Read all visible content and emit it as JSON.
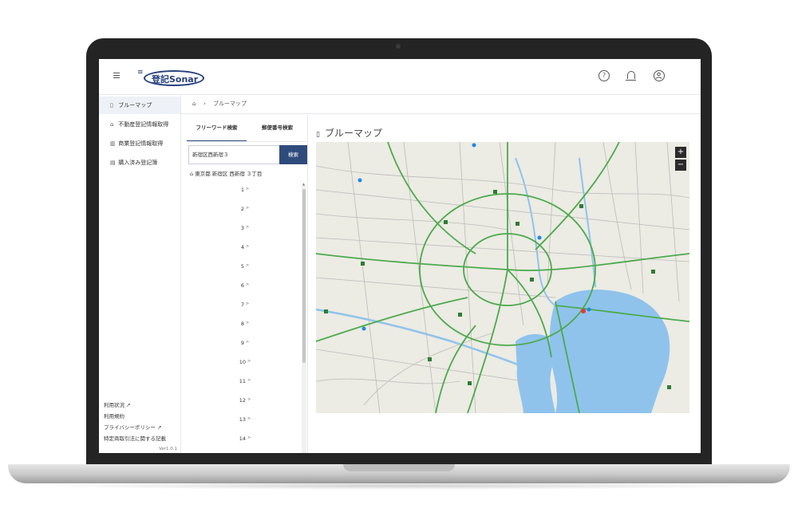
{
  "app": {
    "logo_text": "登記Sonar",
    "version": "Ver1.0.1"
  },
  "header": {
    "help_glyph": "?",
    "icons": [
      "hamburger-menu-icon",
      "help-icon",
      "bell-icon",
      "user-account-icon"
    ]
  },
  "sidebar": {
    "items": [
      {
        "icon": "map-icon",
        "label": "ブルーマップ"
      },
      {
        "icon": "building-icon",
        "label": "不動産登記情報取得"
      },
      {
        "icon": "company-icon",
        "label": "商業登記情報取得"
      },
      {
        "icon": "document-icon",
        "label": "購入済み登記簿"
      }
    ],
    "footer_links": [
      "利用状況",
      "利用規約",
      "プライバシーポリシー",
      "特定商取引法に関する記載"
    ]
  },
  "breadcrumb": {
    "current": "ブルーマップ"
  },
  "search": {
    "tabs": [
      "フリーワード検索",
      "郵便番号検索"
    ],
    "input_value": "新宿区西新宿３",
    "button_label": "検索",
    "address": "東京都 新宿区 西新宿 ３丁目",
    "results": [
      "1",
      "2",
      "3",
      "4",
      "5",
      "6",
      "7",
      "8",
      "9",
      "10",
      "11",
      "12",
      "13",
      "14"
    ]
  },
  "map": {
    "title": "ブルーマップ",
    "zoom_in": "+",
    "zoom_out": "−",
    "colors": {
      "land": "#ecebe4",
      "water": "#8fc3ec",
      "road_green": "#4caa4c",
      "road_gray": "#b9b9b9"
    }
  }
}
